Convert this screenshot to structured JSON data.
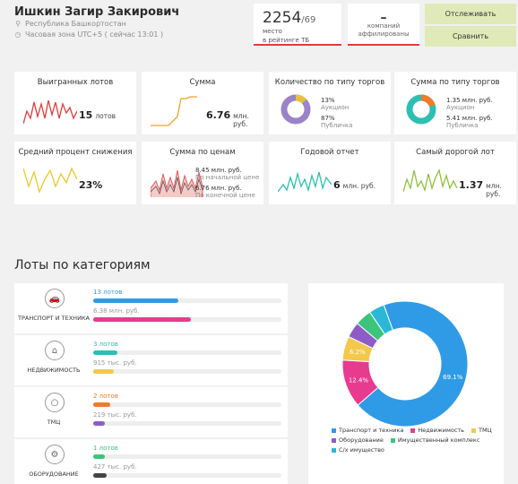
{
  "header": {
    "name": "Ишкин Загир Закирович",
    "region": "Республика Башкортостан",
    "timezone": "Часовая зона UTC+5  ( сейчас 13:01 )",
    "rank_value": "2254",
    "rank_total": "/69",
    "rank_caption_1": "место",
    "rank_caption_2": "в рейтинге ТБ",
    "aff_value": "–",
    "aff_caption_1": "компаний",
    "aff_caption_2": "аффилированы",
    "track_button": "Отслеживать",
    "compare_button": "Сравнить"
  },
  "cards": {
    "won_lots": {
      "title": "Выигранных лотов",
      "value": "15",
      "unit": "лотов"
    },
    "sum": {
      "title": "Сумма",
      "value": "6.76",
      "unit": "млн. руб."
    },
    "type_count": {
      "title": "Количество по типу торгов",
      "pct1": "13%",
      "label1": "Аукцион",
      "pct2": "87%",
      "label2": "Публичка"
    },
    "type_sum": {
      "title": "Сумма по типу торгов",
      "val1": "1.35 млн. руб.",
      "label1": "Аукцион",
      "val2": "5.41 млн. руб.",
      "label2": "Публичка"
    },
    "avg_reduction": {
      "title": "Средний процент снижения",
      "value": "23%"
    },
    "price_sum": {
      "title": "Сумма по ценам",
      "val1": "8.45 млн. руб.",
      "label1": "По начальной цене",
      "val2": "6.76 млн. руб.",
      "label2": "По конечной цене"
    },
    "annual": {
      "title": "Годовой отчет",
      "value": "6",
      "unit": "млн. руб."
    },
    "most_expensive": {
      "title": "Самый дорогой лот",
      "value": "1.37",
      "unit": "млн. руб."
    }
  },
  "colors": {
    "red": "#e23b3b",
    "orange": "#f0a12a",
    "yellow": "#e8c92a",
    "green": "#3cc47c",
    "teal": "#2bb8b0",
    "blue": "#2f9be6",
    "pink": "#e83a8f",
    "purple": "#9b59b6",
    "violet": "#7a4fb8",
    "darkgray": "#444444"
  },
  "categories": {
    "title": "Лоты по категориям",
    "items": [
      {
        "label": "ТРАНСПОРТ И ТЕХНИКА",
        "icon": "car-icon",
        "count": "13 лотов",
        "sum": "6.38 млн. руб.",
        "count_color": "#2f9be6",
        "sum_color": "#e83a8f",
        "count_frac": 0.45,
        "sum_frac": 0.52
      },
      {
        "label": "НЕДВИЖИМОСТЬ",
        "icon": "house-icon",
        "count": "3 лотов",
        "sum": "915 тыс. руб.",
        "count_color": "#2bc0b3",
        "sum_color": "#f2c94c",
        "count_frac": 0.13,
        "sum_frac": 0.11
      },
      {
        "label": "ТМЦ",
        "icon": "lightbulb-icon",
        "count": "2 лотов",
        "sum": "219 тыс. руб.",
        "count_color": "#f07b2a",
        "sum_color": "#8e5cc9",
        "count_frac": 0.09,
        "sum_frac": 0.06
      },
      {
        "label": "ОБОРУДОВАНИЕ",
        "icon": "gear-icon",
        "count": "1 лотов",
        "sum": "427 тыс. руб.",
        "count_color": "#3cc47c",
        "sum_color": "#444444",
        "count_frac": 0.06,
        "sum_frac": 0.07
      }
    ]
  },
  "chart_data": {
    "type": "pie",
    "categories": [
      "Транспорт и техника",
      "Недвижимость",
      "ТМЦ",
      "Оборудование",
      "Имущественный комплекс",
      "С/х имущество"
    ],
    "values": [
      69.1,
      12.4,
      6.2,
      4.0,
      4.3,
      4.0
    ],
    "labels": [
      "69.1%",
      "12.4%",
      "6.2%",
      "",
      "",
      ""
    ],
    "colors": [
      "#2f9be6",
      "#e83a8f",
      "#f2c94c",
      "#8e5cc9",
      "#3cc47c",
      "#2bb8d8"
    ],
    "legend_position": "bottom"
  }
}
